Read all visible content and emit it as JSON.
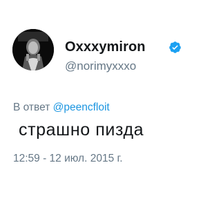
{
  "author": {
    "display_name": "Oxxxymiron",
    "handle": "@norimyxxxo",
    "verified": true,
    "avatar_icon": "user-avatar"
  },
  "reply": {
    "prefix": "В ответ",
    "mention": "@peencfloit"
  },
  "tweet": {
    "text": "страшно пизда",
    "timestamp": "12:59 - 12 июл. 2015 г."
  },
  "colors": {
    "text": "#14171a",
    "secondary": "#657786",
    "link": "#1b95e0",
    "verified_badge": "#1da1f2"
  }
}
